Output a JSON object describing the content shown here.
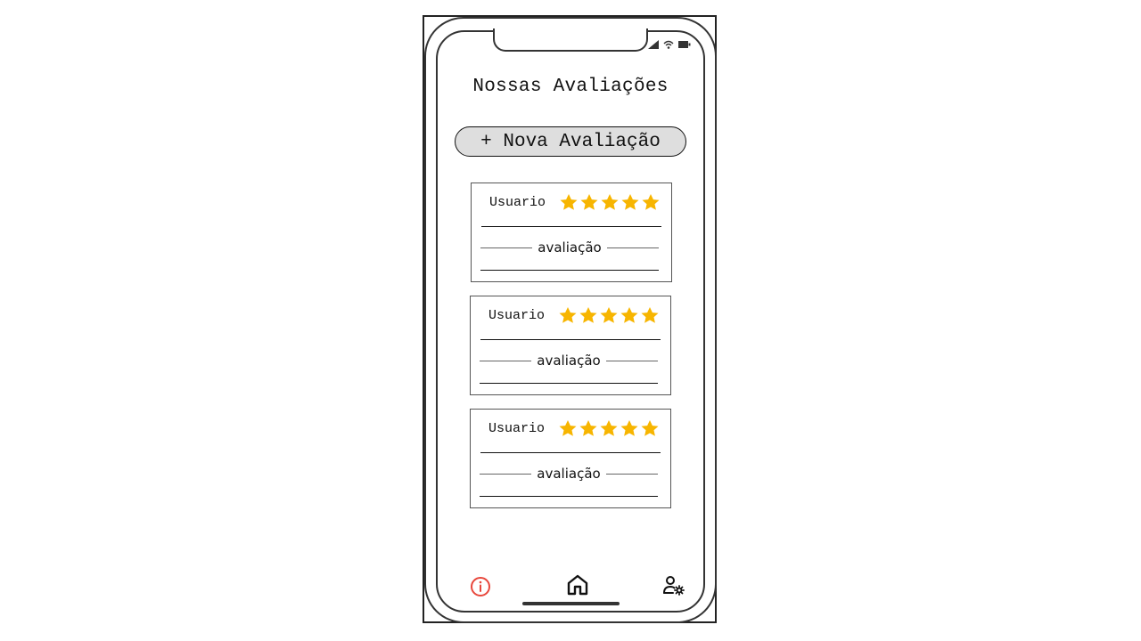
{
  "app": {
    "status_icons": [
      "signal-icon",
      "wifi-icon",
      "battery-icon"
    ]
  },
  "header": {
    "title": "Nossas Avaliações"
  },
  "actions": {
    "new_review_label": "+ Nova Avaliação"
  },
  "reviews": [
    {
      "user": "Usuario",
      "rating": 5,
      "max_rating": 5,
      "text": "avaliação"
    },
    {
      "user": "Usuario",
      "rating": 5,
      "max_rating": 5,
      "text": "avaliação"
    },
    {
      "user": "Usuario",
      "rating": 5,
      "max_rating": 5,
      "text": "avaliação"
    }
  ],
  "bottom_nav": [
    {
      "icon": "info-icon",
      "active": true
    },
    {
      "icon": "home-icon",
      "active": false
    },
    {
      "icon": "user-settings-icon",
      "active": false
    }
  ],
  "colors": {
    "star": "#f7b500",
    "info_accent": "#e8473c",
    "button_bg": "#dedede",
    "outline": "#333333"
  }
}
